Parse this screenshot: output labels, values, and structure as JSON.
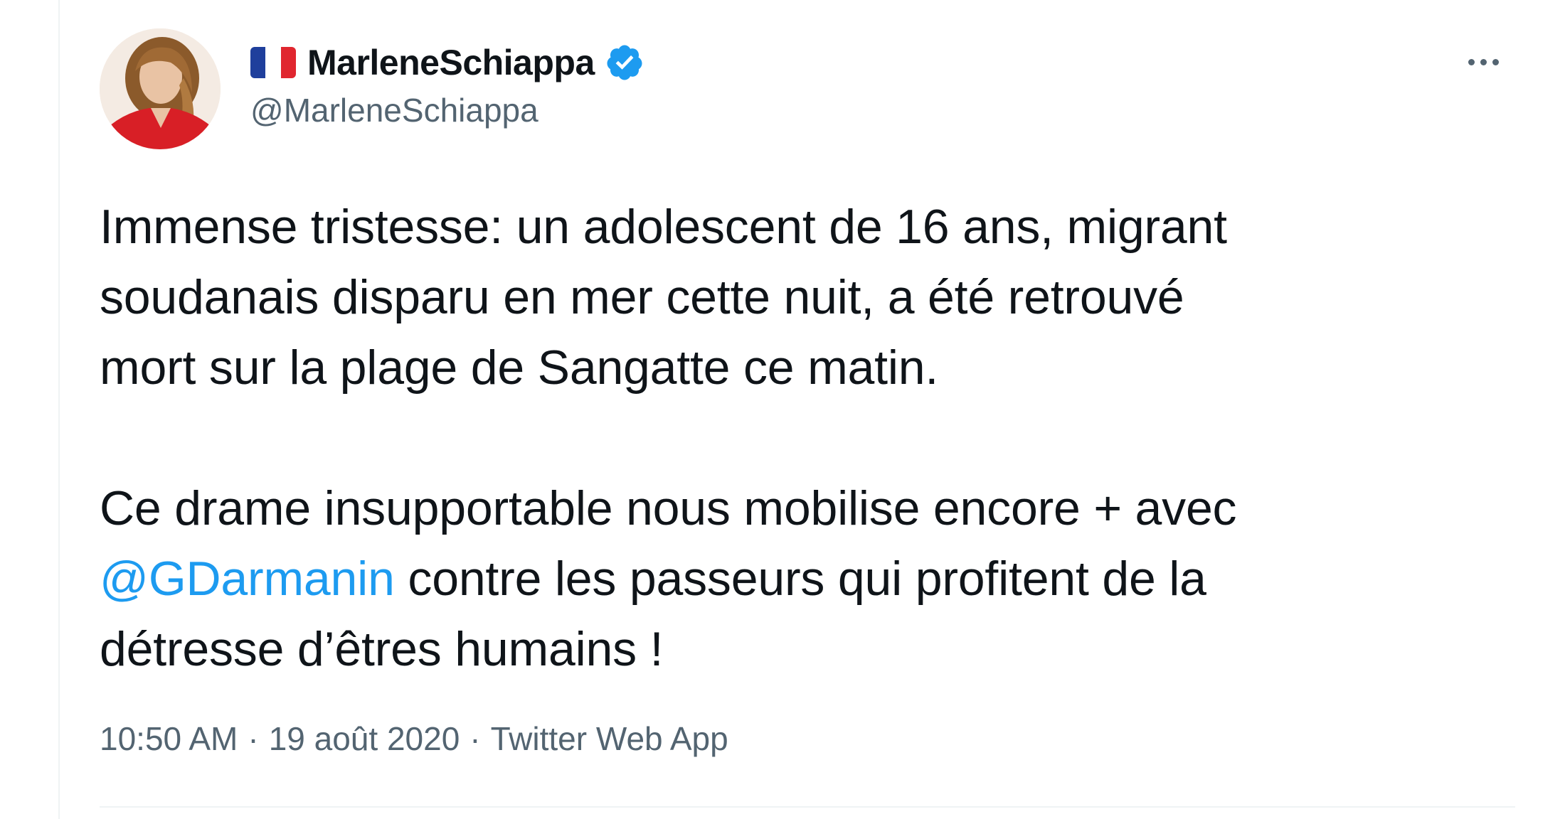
{
  "author": {
    "display_name": "MarleneSchiappa",
    "handle": "@MarleneSchiappa",
    "flag_icon": "france-flag-icon",
    "verified_icon": "verified-badge-icon",
    "avatar": "profile-photo"
  },
  "tweet": {
    "line_1": "Immense tristesse: un adolescent de 16 ans, migrant",
    "line_2": "soudanais disparu en mer cette nuit, a été retrouvé",
    "line_3": "mort sur la plage de Sangatte ce matin.",
    "line_4": "Ce drame insupportable nous mobilise encore + avec",
    "mention": "@GDarmanin",
    "line_5_rest": " contre les passeurs qui profitent de la",
    "line_6": "détresse d’êtres humains !"
  },
  "meta": {
    "time": "10:50 AM",
    "separator": "·",
    "date": "19 août 2020",
    "source": "Twitter Web App"
  },
  "colors": {
    "text": "#0f1419",
    "secondary": "#536471",
    "link": "#1d9bf0",
    "verified": "#1d9bf0"
  },
  "more_icon": "more-options-icon"
}
